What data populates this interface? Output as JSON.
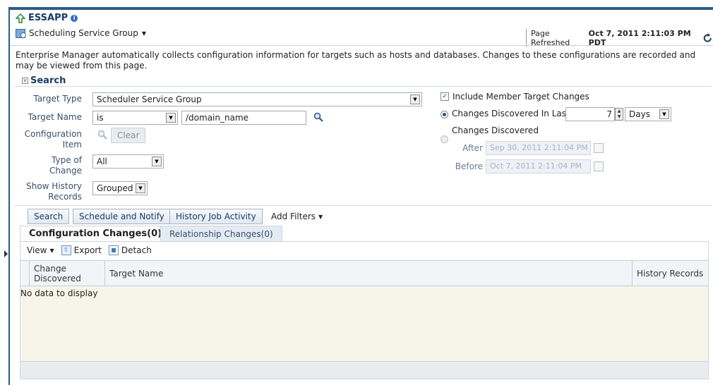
{
  "header": {
    "app_title": "ESSAPP",
    "group_name": "Scheduling Service Group",
    "refresh_label": "Page Refreshed",
    "refresh_time": "Oct 7, 2011 2:11:03 PM PDT"
  },
  "description": "Enterprise Manager automatically collects configuration information for targets such as hosts and databases. Changes to these configurations are recorded and may be viewed from this page.",
  "search": {
    "title": "Search",
    "target_type_label": "Target Type",
    "target_type_value": "Scheduler Service Group",
    "target_name_label": "Target Name",
    "target_name_operator": "is",
    "target_name_value": "/domain_name",
    "config_item_label_1": "Configuration",
    "config_item_label_2": "Item",
    "clear_label": "Clear",
    "type_of_change_label_1": "Type of",
    "type_of_change_label_2": "Change",
    "type_of_change_value": "All",
    "show_history_label_1": "Show History",
    "show_history_label_2": "Records",
    "show_history_value": "Grouped",
    "include_member_label": "Include Member Target Changes",
    "changes_last_label": "Changes Discovered In Last",
    "changes_last_value": "7",
    "changes_last_unit": "Days",
    "changes_discovered_label": "Changes Discovered",
    "after_label": "After",
    "after_value": "Sep 30, 2011 2:11:04 PM",
    "before_label": "Before",
    "before_value": "Oct 7, 2011 2:11:04 PM"
  },
  "actions": {
    "search": "Search",
    "schedule": "Schedule and Notify",
    "history": "History Job Activity",
    "add_filters": "Add Filters"
  },
  "tabs": {
    "config": "Configuration Changes(0)",
    "relationship": "Relationship Changes(0)"
  },
  "toolbar": {
    "view": "View",
    "export": "Export",
    "detach": "Detach"
  },
  "table": {
    "col_change_1": "Change",
    "col_change_2": "Discovered",
    "col_target": "Target Name",
    "col_history": "History Records",
    "empty": "No data to display"
  }
}
